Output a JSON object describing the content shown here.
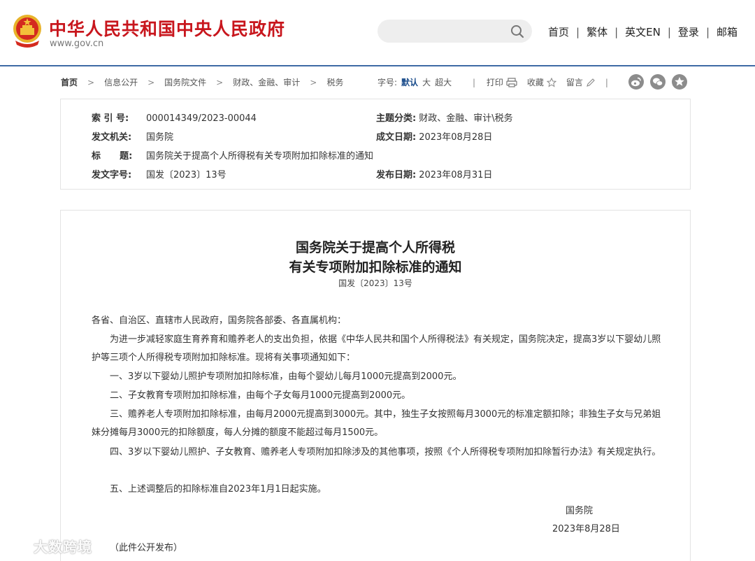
{
  "header": {
    "site_name": "中华人民共和国中央人民政府",
    "site_url": "www.gov.cn",
    "search_placeholder": "",
    "nav": [
      "首页",
      "繁体",
      "英文EN",
      "登录",
      "邮箱"
    ],
    "nav_sep": "|"
  },
  "breadcrumb": {
    "items": [
      "首页",
      "信息公开",
      "国务院文件",
      "财政、金融、审计",
      "税务"
    ],
    "arrow": ">"
  },
  "fontsize": {
    "label": "字号:",
    "options": [
      "默认",
      "大",
      "超大"
    ],
    "selected": "默认"
  },
  "tools": {
    "sep": "|",
    "print": "打印",
    "favorite": "收藏",
    "comment": "留言"
  },
  "share_icons": [
    "weibo-icon",
    "wechat-icon",
    "star-icon"
  ],
  "meta": {
    "index_label": "索 引 号:",
    "index_value": "000014349/2023-00044",
    "topic_label": "主题分类:",
    "topic_value": "财政、金融、审计\\税务",
    "issuer_label": "发文机关:",
    "issuer_value": "国务院",
    "written_label": "成文日期:",
    "written_value": "2023年08月28日",
    "title_label": "标      题:",
    "title_value": "国务院关于提高个人所得税有关专项附加扣除标准的通知",
    "docno_label": "发文字号:",
    "docno_value": "国发〔2023〕13号",
    "published_label": "发布日期:",
    "published_value": "2023年08月31日"
  },
  "document": {
    "title_line1": "国务院关于提高个人所得税",
    "title_line2": "有关专项附加扣除标准的通知",
    "doc_no": "国发〔2023〕13号",
    "addressee": "各省、自治区、直辖市人民政府，国务院各部委、各直属机构：",
    "intro": "为进一步减轻家庭生育养育和赡养老人的支出负担，依据《中华人民共和国个人所得税法》有关规定，国务院决定，提高3岁以下婴幼儿照护等三项个人所得税专项附加扣除标准。现将有关事项通知如下：",
    "item1": "一、3岁以下婴幼儿照护专项附加扣除标准，由每个婴幼儿每月1000元提高到2000元。",
    "item2": "二、子女教育专项附加扣除标准，由每个子女每月1000元提高到2000元。",
    "item3": "三、赡养老人专项附加扣除标准，由每月2000元提高到3000元。其中，独生子女按照每月3000元的标准定额扣除；非独生子女与兄弟姐妹分摊每月3000元的扣除额度，每人分摊的额度不能超过每月1500元。",
    "item4": "四、3岁以下婴幼儿照护、子女教育、赡养老人专项附加扣除涉及的其他事项，按照《个人所得税专项附加扣除暂行办法》有关规定执行。",
    "item5": "五、上述调整后的扣除标准自2023年1月1日起实施。",
    "signatory": "国务院",
    "sign_date": "2023年8月28日",
    "publish_note": "（此件公开发布）"
  },
  "watermark": "大数跨境",
  "colors": {
    "brand_red": "#c8161d",
    "header_line": "#3e6aa5",
    "selected_font": "#1a4c8b"
  }
}
